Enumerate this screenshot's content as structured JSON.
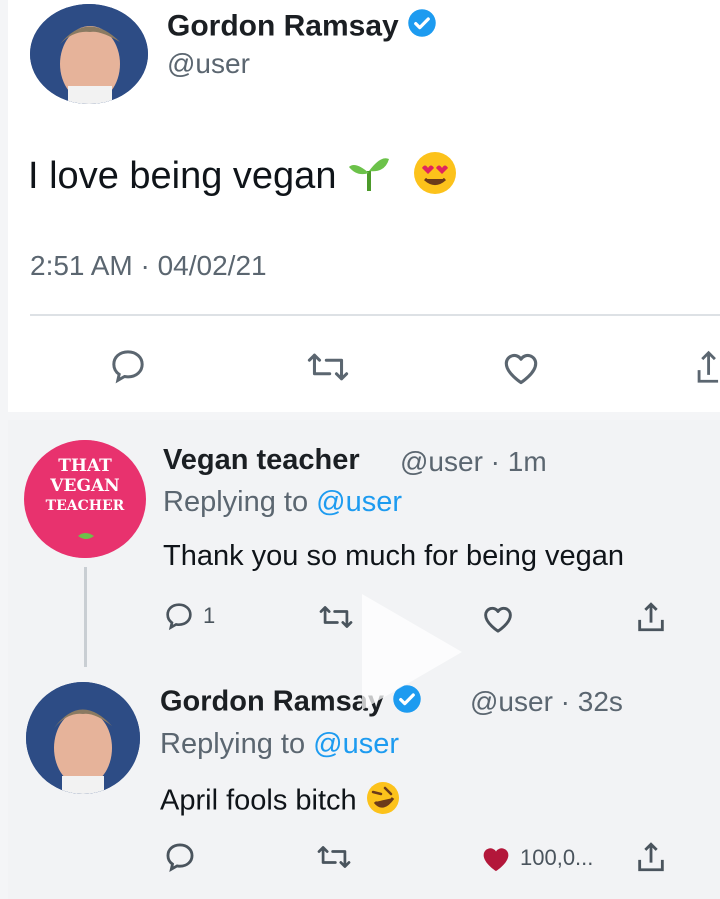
{
  "tweet": {
    "author_name": "Gordon Ramsay",
    "author_handle": "@user",
    "text": "I love being vegan",
    "emojis": [
      "seedling-emoji",
      "heart-eyes-emoji"
    ],
    "timestamp": "2:51 AM · 04/02/21"
  },
  "reply1": {
    "author_name": "Vegan teacher",
    "handle_time": "@user · 1m",
    "replying_prefix": "Replying to",
    "replying_handle": "@user",
    "text": "Thank you so much for being vegan",
    "reply_count": "1",
    "avatar_lines": [
      "THAT",
      "VEGAN",
      "TEACHER"
    ]
  },
  "reply2": {
    "author_name": "Gordon Ramsay",
    "handle_time": "@user · 32s",
    "replying_prefix": "Replying to",
    "replying_handle": "@user",
    "text": "April fools bitch",
    "emoji": "rolling-laughing-emoji",
    "like_count": "100,0..."
  },
  "colors": {
    "verified": "#1d9bf0",
    "link": "#1d9bf0",
    "like_filled": "#b3173a",
    "vegan_avatar_bg": "#e8326e"
  }
}
